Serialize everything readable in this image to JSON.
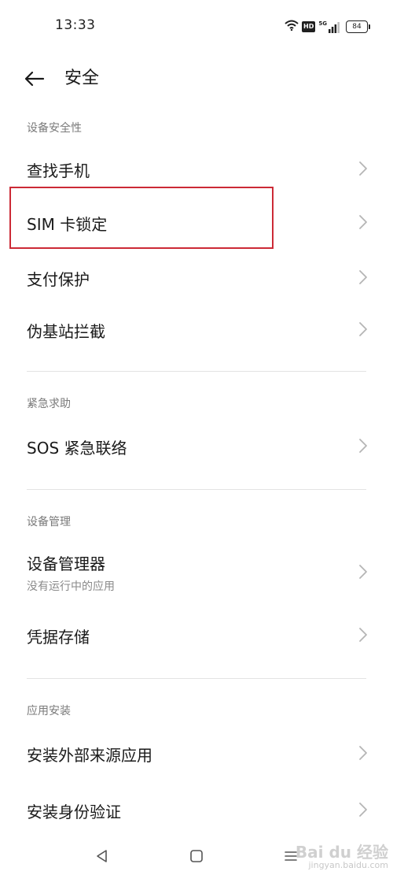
{
  "status_bar": {
    "time": "13:33",
    "hd_label": "HD",
    "network_label": "5G",
    "battery_level": "84"
  },
  "app_bar": {
    "title": "安全",
    "back_icon": "arrow-left-icon"
  },
  "sections": [
    {
      "header": "设备安全性",
      "items": [
        {
          "label": "查找手机"
        },
        {
          "label": "SIM 卡锁定",
          "highlighted": true
        },
        {
          "label": "支付保护"
        },
        {
          "label": "伪基站拦截"
        }
      ]
    },
    {
      "header": "紧急求助",
      "items": [
        {
          "label": "SOS 紧急联络"
        }
      ]
    },
    {
      "header": "设备管理",
      "items": [
        {
          "label": "设备管理器",
          "sublabel": "没有运行中的应用"
        },
        {
          "label": "凭据存储"
        }
      ]
    },
    {
      "header": "应用安装",
      "items": [
        {
          "label": "安装外部来源应用"
        },
        {
          "label": "安装身份验证"
        }
      ]
    }
  ],
  "nav_bar": {
    "back_icon": "triangle-back-icon",
    "home_icon": "square-home-icon",
    "menu_icon": "menu-lines-icon"
  },
  "watermark": {
    "brand": "Bai du 经验",
    "url": "jingyan.baidu.com"
  },
  "colors": {
    "highlight_border": "#cc2a36",
    "section_header": "#7a7a7a",
    "divider": "#e3e3e3"
  }
}
